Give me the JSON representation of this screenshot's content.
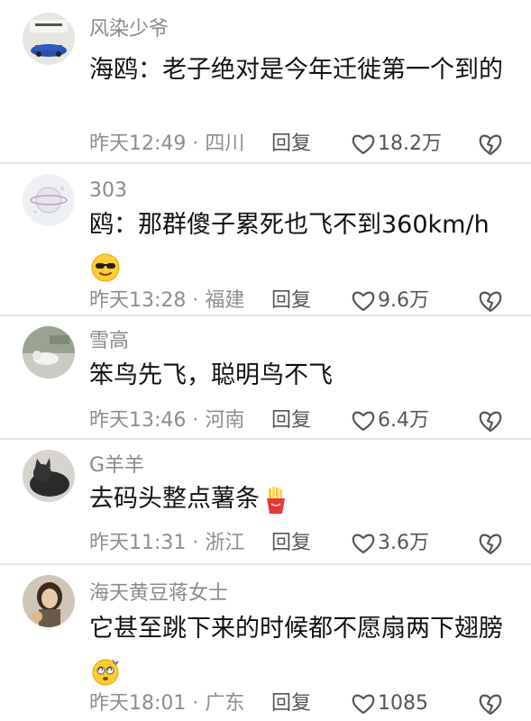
{
  "comments": [
    {
      "username": "风染少爷",
      "text": "海鸥：老子绝对是今年迁徙第一个到的",
      "time": "昨天12:49 · 四川",
      "reply": "回复",
      "likes": "18.2万",
      "emoji": null
    },
    {
      "username": "303",
      "text": "鸥：那群傻子累死也飞不到360km/h",
      "time": "昨天13:28 · 福建",
      "reply": "回复",
      "likes": "9.6万",
      "emoji": "sunglasses-emoji"
    },
    {
      "username": "雪高",
      "text": "笨鸟先飞，聪明鸟不飞",
      "time": "昨天13:46 · 河南",
      "reply": "回复",
      "likes": "6.4万",
      "emoji": null
    },
    {
      "username": "G羊羊",
      "text": "去码头整点薯条",
      "time": "昨天11:31 · 浙江",
      "reply": "回复",
      "likes": "3.6万",
      "emoji": "fries-emoji"
    },
    {
      "username": "海天黄豆蒋女士",
      "text": "它甚至跳下来的时候都不愿扇两下翅膀",
      "time": "昨天18:01 · 广东",
      "reply": "回复",
      "likes": "1085",
      "emoji": "dizzy-face-emoji"
    }
  ],
  "colors": {
    "username": "#8a8a8a",
    "text": "#111111",
    "meta": "#8e8e8e",
    "divider": "#e3e3e3"
  }
}
